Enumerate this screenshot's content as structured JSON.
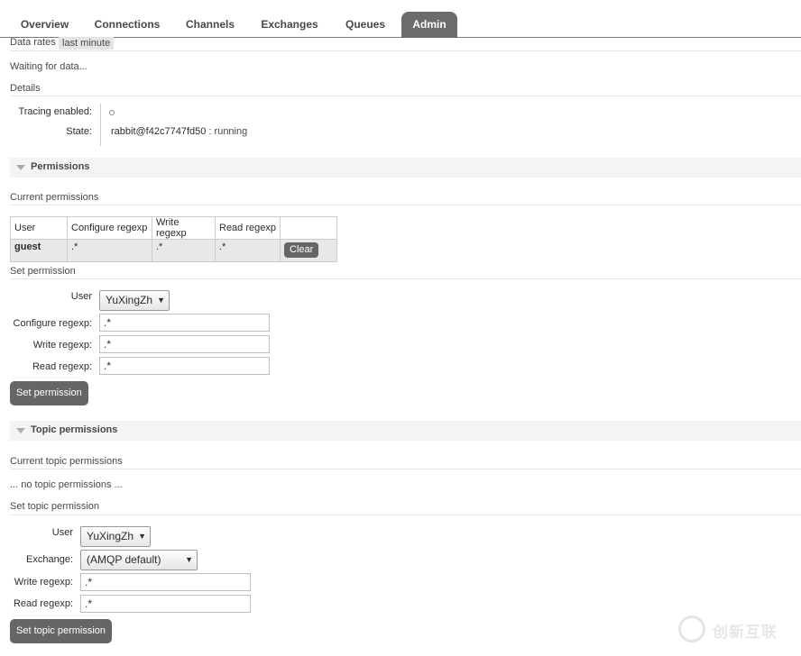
{
  "nav": {
    "tabs": [
      {
        "label": "Overview"
      },
      {
        "label": "Connections"
      },
      {
        "label": "Channels"
      },
      {
        "label": "Exchanges"
      },
      {
        "label": "Queues"
      },
      {
        "label": "Admin",
        "active": true
      }
    ]
  },
  "data_rates": {
    "label": "Data rates",
    "value": "last minute"
  },
  "waiting_text": "Waiting for data...",
  "details": {
    "heading": "Details",
    "tracing_label": "Tracing enabled:",
    "state_label": "State:",
    "state_node": "rabbit@f42c7747fd50",
    "state_status": ": running"
  },
  "permissions": {
    "section_title": "Permissions",
    "current_heading": "Current permissions",
    "table": {
      "headers": [
        "User",
        "Configure regexp",
        "Write regexp",
        "Read regexp",
        ""
      ],
      "rows": [
        {
          "user": "guest",
          "configure": ".*",
          "write": ".*",
          "read": ".*",
          "action": "Clear"
        }
      ]
    },
    "set_heading": "Set permission",
    "form": {
      "user_label": "User",
      "user_value": "YuXingZh",
      "configure_label": "Configure regexp:",
      "configure_value": ".*",
      "write_label": "Write regexp:",
      "write_value": ".*",
      "read_label": "Read regexp:",
      "read_value": ".*",
      "submit_label": "Set permission"
    }
  },
  "topic_permissions": {
    "section_title": "Topic permissions",
    "current_heading": "Current topic permissions",
    "empty_text": "... no topic permissions ...",
    "set_heading": "Set topic permission",
    "form": {
      "user_label": "User",
      "user_value": "YuXingZh",
      "exchange_label": "Exchange:",
      "exchange_value": "(AMQP default)",
      "write_label": "Write regexp:",
      "write_value": ".*",
      "read_label": "Read regexp:",
      "read_value": ".*",
      "submit_label": "Set topic permission"
    }
  },
  "watermark": {
    "text": "创新互联"
  },
  "icons": {
    "dropdown": "triangle-down-icon",
    "collapse": "collapse-triangle-icon"
  }
}
